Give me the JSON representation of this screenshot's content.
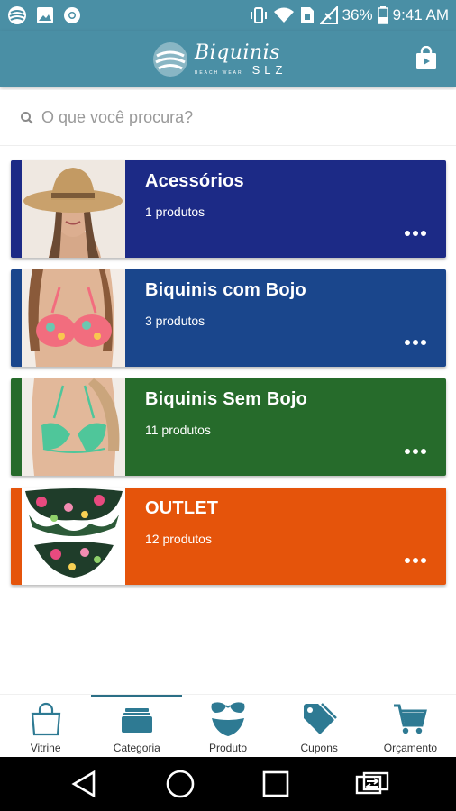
{
  "status_bar": {
    "battery": "36%",
    "time": "9:41 AM",
    "left_icons": [
      "app-icon",
      "image-icon",
      "chrome-icon"
    ],
    "right_icons": [
      "vibrate-icon",
      "wifi-icon",
      "sim-icon",
      "signal-icon",
      "battery-icon"
    ]
  },
  "header": {
    "logo_main": "Biquinis",
    "logo_sub": "SLZ",
    "logo_tagline": "BEACH WEAR",
    "cart_icon": "shopping-bag-icon"
  },
  "search": {
    "placeholder": "O que você procura?",
    "value": ""
  },
  "categories": [
    {
      "title": "Acessórios",
      "count": "1 produtos",
      "color": "#1c2a86",
      "stripe": "#1c2a86",
      "image": "hat-woman"
    },
    {
      "title": "Biquinis com Bojo",
      "count": "3 produtos",
      "color": "#1a468c",
      "stripe": "#1a468c",
      "image": "floral-bikini-top"
    },
    {
      "title": "Biquinis Sem Bojo",
      "count": "11 produtos",
      "color": "#266b2b",
      "stripe": "#266b2b",
      "image": "green-bikini-top"
    },
    {
      "title": "OUTLET",
      "count": "12 produtos",
      "color": "#e5540b",
      "stripe": "#e5540b",
      "image": "floral-bikini-set"
    }
  ],
  "bottom_nav": {
    "active": "Categoria",
    "items": [
      {
        "label": "Vitrine",
        "icon": "shopping-bag-icon"
      },
      {
        "label": "Categoria",
        "icon": "folders-icon"
      },
      {
        "label": "Produto",
        "icon": "bikini-icon"
      },
      {
        "label": "Cupons",
        "icon": "tags-icon"
      },
      {
        "label": "Orçamento",
        "icon": "cart-icon"
      }
    ]
  },
  "colors": {
    "primary": "#4a8fa5",
    "nav_icon": "#2e7a93",
    "nav_active_bar": "#2b6f86"
  }
}
